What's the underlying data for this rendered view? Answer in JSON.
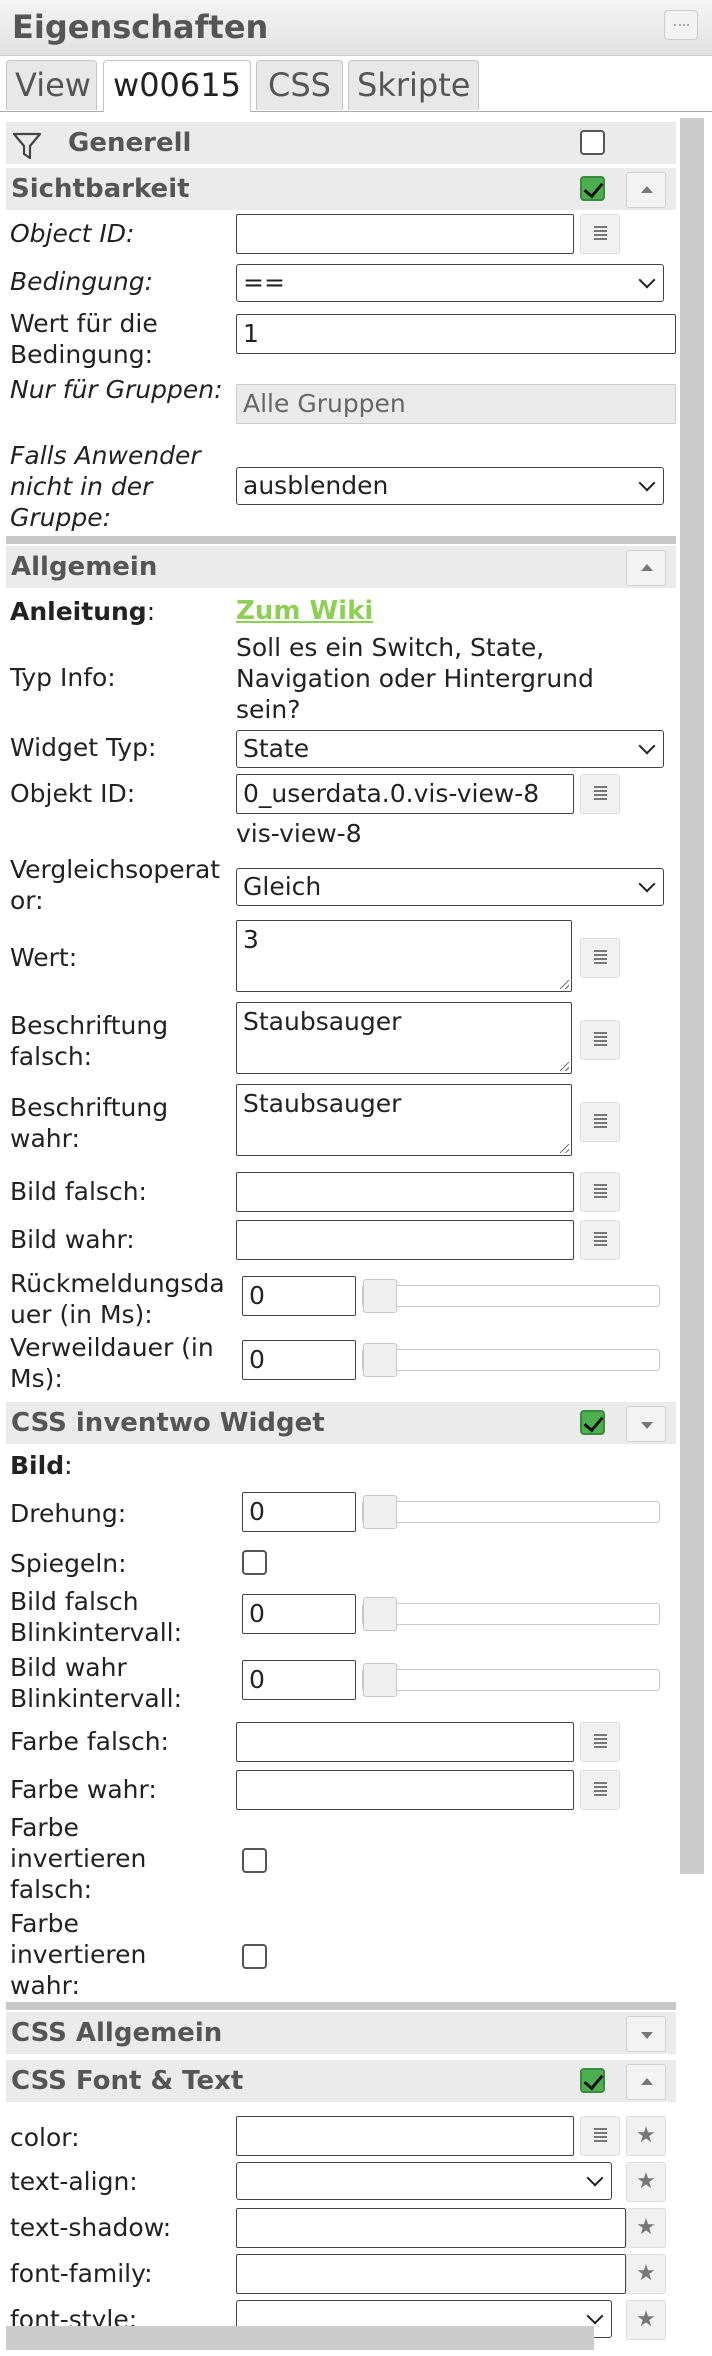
{
  "window": {
    "title": "Eigenschaften"
  },
  "tabs": [
    {
      "label": "View"
    },
    {
      "label": "w00615"
    },
    {
      "label": "CSS"
    },
    {
      "label": "Skripte"
    }
  ],
  "groups": {
    "generell": "Generell",
    "sichtbarkeit": "Sichtbarkeit",
    "allgemein": "Allgemein",
    "css_inventwo": "CSS inventwo Widget",
    "css_allgemein": "CSS Allgemein",
    "css_font": "CSS Font & Text"
  },
  "sichtbarkeit": {
    "object_id_label": "Object ID:",
    "object_id_value": "",
    "bedingung_label": "Bedingung:",
    "bedingung_value": "==",
    "wert_label": "Wert für die Bedingung:",
    "wert_value": "1",
    "gruppen_label": "Nur für Gruppen:",
    "gruppen_value": "Alle Gruppen",
    "falls_label": "Falls Anwender nicht in der Gruppe:",
    "falls_value": "ausblenden"
  },
  "allgemein": {
    "anleitung_label": "Anleitung",
    "anleitung_colon": ":",
    "anleitung_link": "Zum Wiki",
    "typinfo_label": "Typ Info:",
    "typinfo_text": "Soll es ein Switch, State, Navigation oder Hintergrund sein?",
    "widgettyp_label": "Widget Typ:",
    "widgettyp_value": "State",
    "objektid_label": "Objekt ID:",
    "objektid_value": "0_userdata.0.vis-view-8",
    "objektid_hint": "vis-view-8",
    "vergleich_label": "Vergleichsoperator:",
    "vergleich_value": "Gleich",
    "wert_label": "Wert:",
    "wert_value": "3",
    "beschr_falsch_label": "Beschriftung falsch:",
    "beschr_falsch_value": "Staubsauger",
    "beschr_wahr_label": "Beschriftung wahr:",
    "beschr_wahr_value": "Staubsauger",
    "bild_falsch_label": "Bild falsch:",
    "bild_wahr_label": "Bild wahr:",
    "rueck_label": "Rückmeldungsdauer (in Ms):",
    "rueck_value": "0",
    "verweil_label": "Verweildauer (in Ms):",
    "verweil_value": "0"
  },
  "inventwo": {
    "bild_label": "Bild",
    "bild_colon": ":",
    "drehung_label": "Drehung:",
    "drehung_value": "0",
    "spiegeln_label": "Spiegeln:",
    "bf_blink_label": "Bild falsch Blinkintervall:",
    "bf_blink_value": "0",
    "bw_blink_label": "Bild wahr Blinkintervall:",
    "bw_blink_value": "0",
    "farbe_falsch_label": "Farbe falsch:",
    "farbe_wahr_label": "Farbe wahr:",
    "farbe_inv_falsch_label": "Farbe invertieren falsch:",
    "farbe_inv_wahr_label": "Farbe invertieren wahr:"
  },
  "font": {
    "color_label": "color:",
    "textalign_label": "text-align:",
    "textshadow_label": "text-shadow:",
    "fontfamily_label": "font-family:",
    "fontstyle_label": "font-style:"
  },
  "colors": {
    "accent_link": "#8ecf55",
    "check_on": "#4caf50",
    "group_bg": "#ebebeb"
  }
}
